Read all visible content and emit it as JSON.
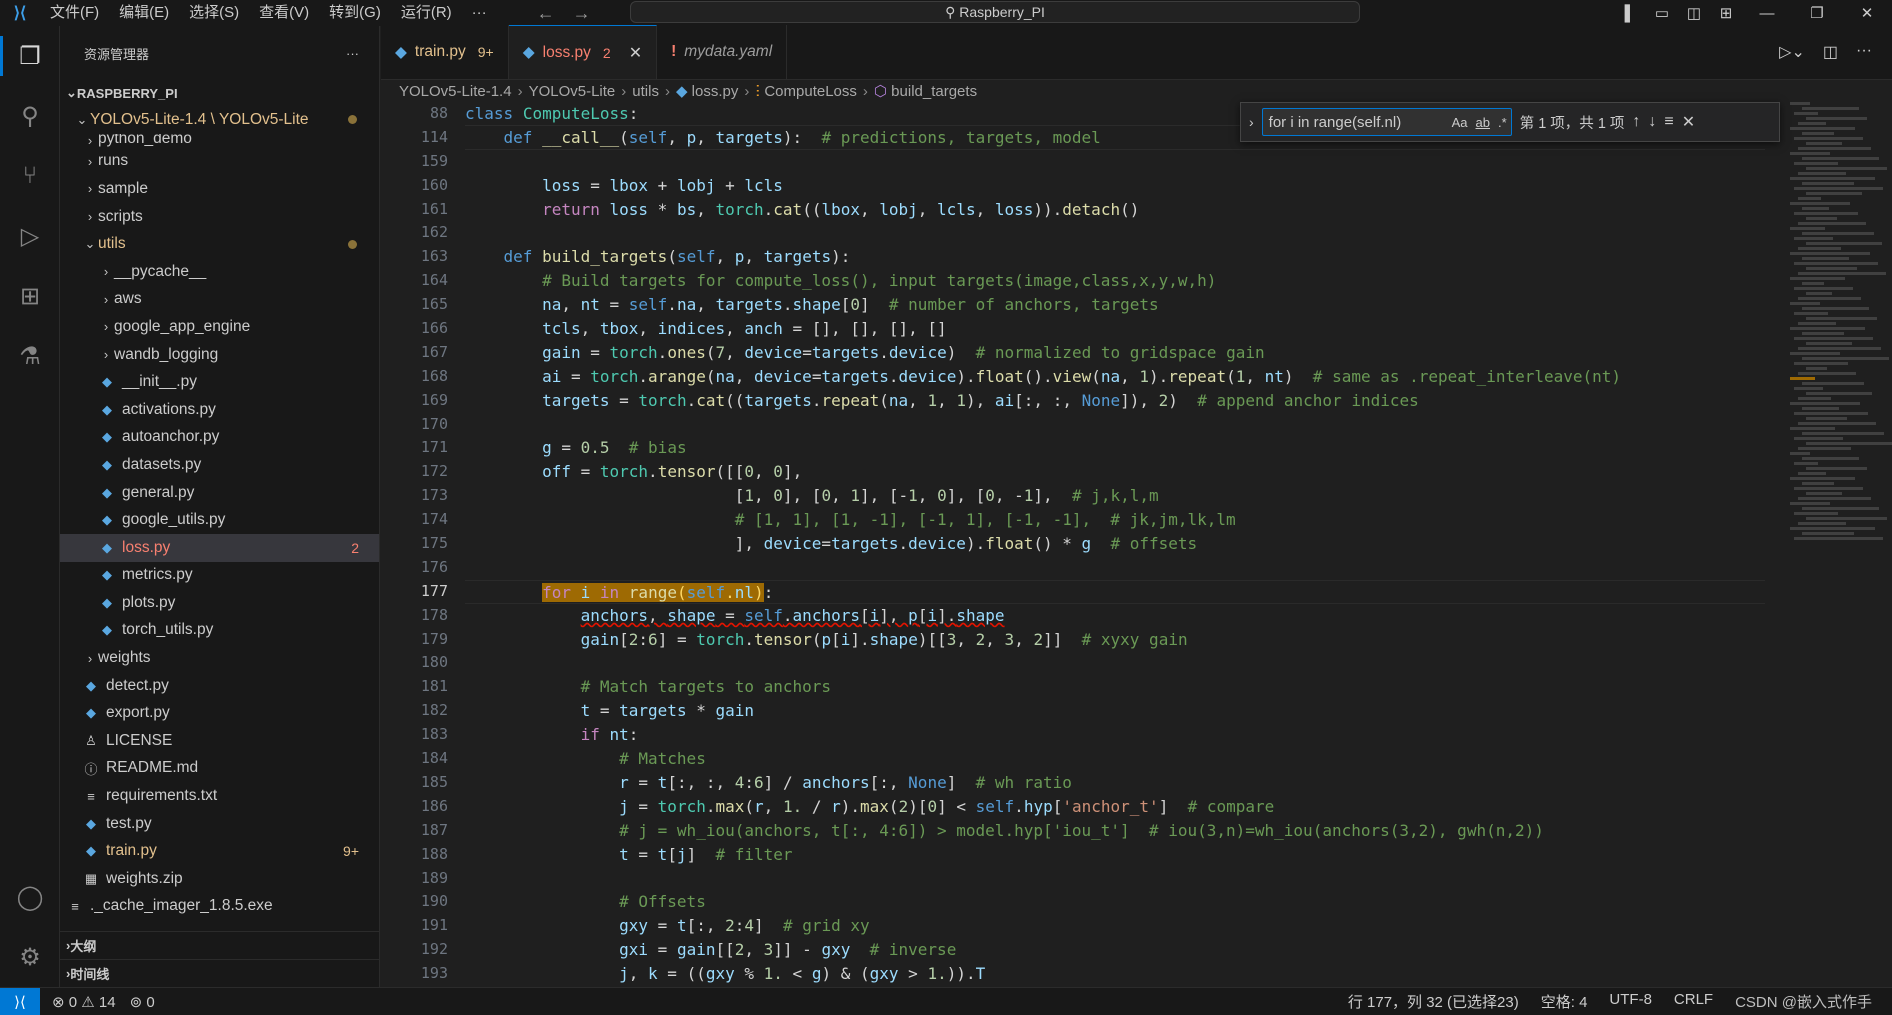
{
  "titlebar": {
    "menu": [
      "文件(F)",
      "编辑(E)",
      "选择(S)",
      "查看(V)",
      "转到(G)",
      "运行(R)",
      "···"
    ],
    "command_center": "Raspberry_PI"
  },
  "sidebar": {
    "title": "资源管理器",
    "more": "···",
    "root": "RASPBERRY_PI",
    "folder_path": "YOLOv5-Lite-1.4 \\ YOLOv5-Lite",
    "items": [
      {
        "label": "python_demo",
        "type": "folder",
        "indent": 1
      },
      {
        "label": "runs",
        "type": "folder",
        "indent": 1
      },
      {
        "label": "sample",
        "type": "folder",
        "indent": 1
      },
      {
        "label": "scripts",
        "type": "folder",
        "indent": 1
      },
      {
        "label": "utils",
        "type": "folder-open",
        "indent": 1,
        "modified": true
      },
      {
        "label": "__pycache__",
        "type": "folder",
        "indent": 2
      },
      {
        "label": "aws",
        "type": "folder",
        "indent": 2
      },
      {
        "label": "google_app_engine",
        "type": "folder",
        "indent": 2
      },
      {
        "label": "wandb_logging",
        "type": "folder",
        "indent": 2
      },
      {
        "label": "__init__.py",
        "type": "py",
        "indent": 2
      },
      {
        "label": "activations.py",
        "type": "py",
        "indent": 2
      },
      {
        "label": "autoanchor.py",
        "type": "py",
        "indent": 2
      },
      {
        "label": "datasets.py",
        "type": "py",
        "indent": 2
      },
      {
        "label": "general.py",
        "type": "py",
        "indent": 2
      },
      {
        "label": "google_utils.py",
        "type": "py",
        "indent": 2
      },
      {
        "label": "loss.py",
        "type": "py",
        "indent": 2,
        "badge": "2",
        "selected": true
      },
      {
        "label": "metrics.py",
        "type": "py",
        "indent": 2
      },
      {
        "label": "plots.py",
        "type": "py",
        "indent": 2
      },
      {
        "label": "torch_utils.py",
        "type": "py",
        "indent": 2
      },
      {
        "label": "weights",
        "type": "folder",
        "indent": 1
      },
      {
        "label": "detect.py",
        "type": "py",
        "indent": 1
      },
      {
        "label": "export.py",
        "type": "py",
        "indent": 1
      },
      {
        "label": "LICENSE",
        "type": "license",
        "indent": 1
      },
      {
        "label": "README.md",
        "type": "info",
        "indent": 1
      },
      {
        "label": "requirements.txt",
        "type": "txt",
        "indent": 1
      },
      {
        "label": "test.py",
        "type": "py",
        "indent": 1
      },
      {
        "label": "train.py",
        "type": "py",
        "indent": 1,
        "badge": "9+",
        "modified": true
      },
      {
        "label": "weights.zip",
        "type": "zip",
        "indent": 1
      },
      {
        "label": "._cache_imager_1.8.5.exe",
        "type": "txt",
        "indent": 0
      }
    ],
    "outline": "大纲",
    "timeline": "时间线"
  },
  "tabs": [
    {
      "label": "train.py",
      "badge": "9+",
      "active": false,
      "kind": "mod"
    },
    {
      "label": "loss.py",
      "badge": "2",
      "active": true,
      "kind": "err"
    },
    {
      "label": "mydata.yaml",
      "badge": "",
      "active": false,
      "kind": "yaml"
    }
  ],
  "breadcrumb": [
    "YOLOv5-Lite-1.4",
    "YOLOv5-Lite",
    "utils",
    "loss.py",
    "ComputeLoss",
    "build_targets"
  ],
  "find": {
    "query": "for i in range(self.nl)",
    "opt_case": "Aa",
    "opt_word": "ab",
    "opt_regex": ".*",
    "count": "第 1 项，共 1 项"
  },
  "editor": {
    "sticky_lines": [
      "88",
      "114"
    ],
    "line_numbers": [
      "159",
      "160",
      "161",
      "162",
      "163",
      "164",
      "165",
      "166",
      "167",
      "168",
      "169",
      "170",
      "171",
      "172",
      "173",
      "174",
      "175",
      "176",
      "177",
      "178",
      "179",
      "180",
      "181",
      "182",
      "183",
      "184",
      "185",
      "186",
      "187",
      "188",
      "189",
      "190",
      "191",
      "192",
      "193"
    ],
    "current_line": "177"
  },
  "statusbar": {
    "errors": "0",
    "warnings": "14",
    "ports": "0",
    "position": "行 177，列 32 (已选择23)",
    "spaces": "空格: 4",
    "encoding": "UTF-8",
    "eol": "CRLF",
    "watermark": "CSDN @嵌入式作手"
  },
  "colors": {
    "accent": "#0078d4",
    "modified": "#e2c08d",
    "error": "#f88070",
    "find_highlight": "#9e6a03"
  }
}
